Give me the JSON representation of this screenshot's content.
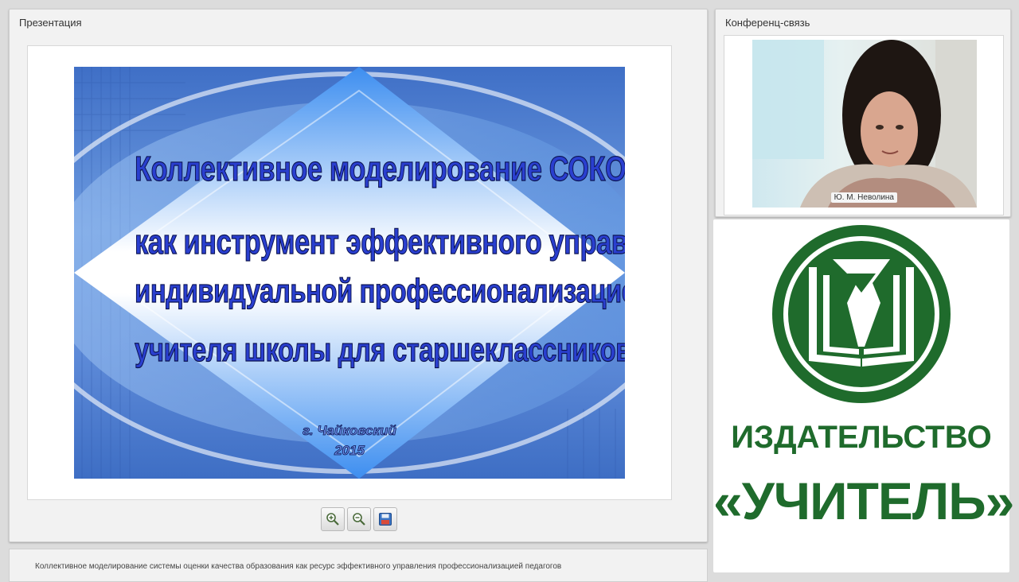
{
  "presentation_panel": {
    "title": "Презентация",
    "slide": {
      "lines": [
        "Коллективное моделирование СОКО НОЦ",
        "как инструмент эффективного управления",
        "индивидуальной профессионализацией",
        "учителя школы для старшеклассников"
      ],
      "city": "г. Чайковский",
      "year": "2015"
    },
    "toolbar": {
      "zoom_in_icon": "zoom-in",
      "zoom_out_icon": "zoom-out",
      "save_icon": "floppy-disk"
    }
  },
  "conference_panel": {
    "title": "Конференц-связь",
    "participant_name": "Ю. М. Неволина"
  },
  "logo": {
    "line1": "ИЗДАТЕЛЬСТВО",
    "line2": "«УЧИТЕЛЬ»",
    "color": "#1f6b2c"
  },
  "bottom_bar": {
    "caption": "Коллективное моделирование системы оценки качества образования как ресурс эффективного управления профессионализацией педагогов"
  }
}
